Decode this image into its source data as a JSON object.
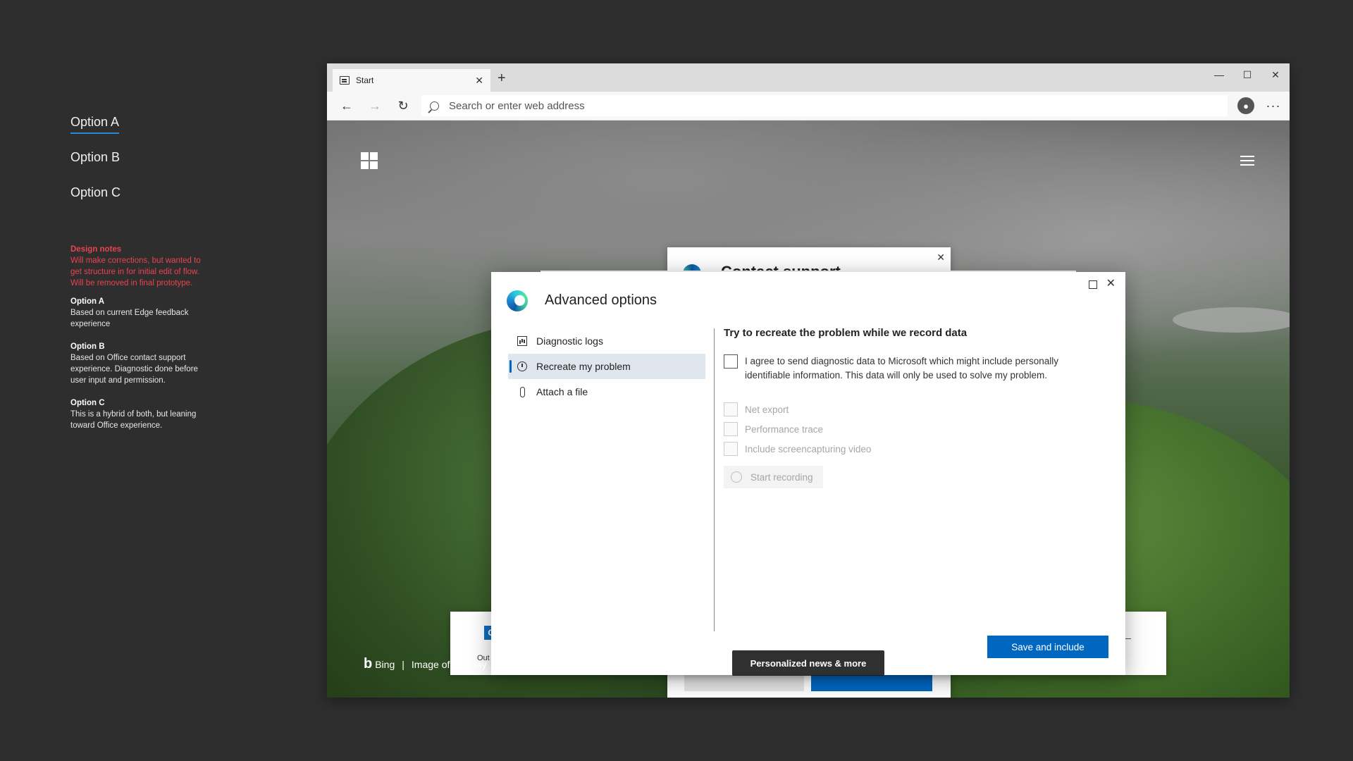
{
  "options": [
    {
      "label": "Option A",
      "active": true
    },
    {
      "label": "Option B",
      "active": false
    },
    {
      "label": "Option C",
      "active": false
    }
  ],
  "notes": {
    "heading": "Design notes",
    "body": "Will make corrections, but wanted to get structure in for initial edit of flow. Will be removed in final prototype.",
    "items": [
      {
        "title": "Option A",
        "text": "Based on current Edge feedback experience"
      },
      {
        "title": "Option B",
        "text": "Based on Office contact support experience. Diagnostic done before user input and permission."
      },
      {
        "title": "Option C",
        "text": "This is a hybrid of both, but leaning toward Office experience."
      }
    ]
  },
  "browser": {
    "tab_title": "Start",
    "tab_close": "✕",
    "new_tab": "+",
    "win_min": "—",
    "win_max": "☐",
    "win_close": "✕",
    "address_placeholder": "Search or enter web address",
    "back": "←",
    "forward": "→",
    "refresh": "↻",
    "more": "···"
  },
  "page": {
    "bing": "Bing",
    "bing_sep": "|",
    "image_of_day": "Image of the Day",
    "personalized": "Personalized news & more"
  },
  "background_dialogs": {
    "contact_title": "Contact support",
    "office_label": "Out"
  },
  "dialog": {
    "title": "Advanced options",
    "close": "✕",
    "nav": [
      {
        "label": "Diagnostic logs",
        "icon": "chart-icon",
        "active": false
      },
      {
        "label": "Recreate my problem",
        "icon": "clock-icon",
        "active": true
      },
      {
        "label": "Attach a file",
        "icon": "paperclip-icon",
        "active": false
      }
    ],
    "panel_title": "Try to recreate the problem while we record data",
    "agree_text": "I agree to send diagnostic data to Microsoft which might include personally identifiable information. This data will only be used to solve my problem.",
    "options": [
      "Net export",
      "Performance trace",
      "Include screencapturing video"
    ],
    "start_recording": "Start recording",
    "save_button": "Save and include"
  }
}
